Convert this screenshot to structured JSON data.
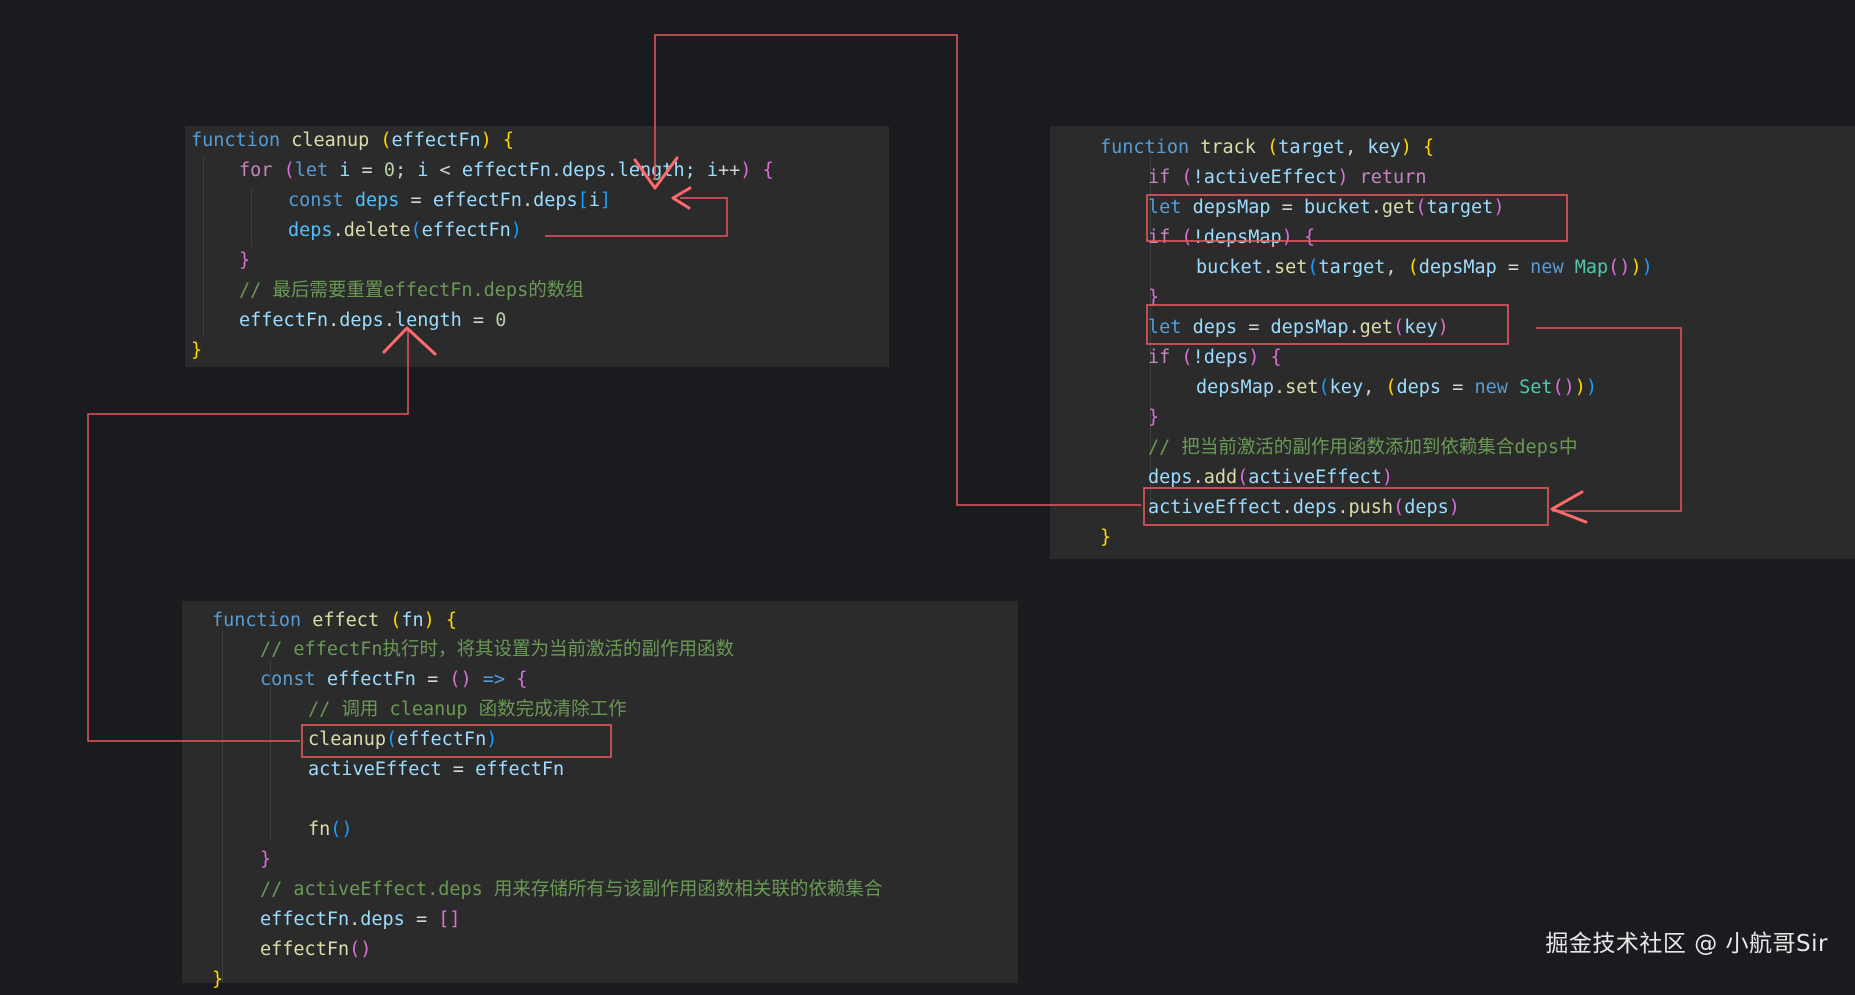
{
  "cleanup": {
    "l1": {
      "a": "function",
      "b": "cleanup",
      "c": "(",
      "d": "effectFn",
      "e": ")",
      "f": "{"
    },
    "l2": {
      "a": "for",
      "b": "(",
      "c": "let",
      "d": "i",
      "e": "=",
      "f": "0",
      "g": ";",
      "h": "i",
      "i": "<",
      "j": "effectFn",
      "k": ".deps.length; ",
      "l": "i",
      "m": "++",
      "n": ")",
      "o": "{"
    },
    "l3": {
      "a": "const",
      "b": "deps",
      "c": "=",
      "d": "effectFn",
      "e": ".",
      "f": "deps",
      "g": "[",
      "h": "i",
      "i": "]"
    },
    "l4": {
      "a": "deps",
      "b": ".",
      "c": "delete",
      "d": "(",
      "e": "effectFn",
      "f": ")"
    },
    "l5": {
      "a": "}"
    },
    "l6": {
      "a": "// 最后需要重置effectFn.deps的数组"
    },
    "l7": {
      "a": "effectFn",
      "b": ".",
      "c": "deps",
      "d": ".",
      "e": "length",
      "f": "=",
      "g": "0"
    },
    "l8": {
      "a": "}"
    }
  },
  "track": {
    "l1": {
      "a": "function",
      "b": "track",
      "c": "(",
      "d": "target",
      "e": ",",
      "f": "key",
      "g": ")",
      "h": "{"
    },
    "l2": {
      "a": "if",
      "b": "(",
      "c": "!activeEffect",
      "d": ")",
      "e": "return"
    },
    "l3": {
      "a": "let",
      "b": "depsMap",
      "c": "=",
      "d": "bucket",
      "e": ".",
      "f": "get",
      "g": "(",
      "h": "target",
      "i": ")"
    },
    "l4": {
      "a": "if",
      "b": "(",
      "c": "!depsMap",
      "d": ")",
      "e": "{"
    },
    "l5": {
      "a": "bucket",
      "b": ".",
      "c": "set",
      "d": "(",
      "e": "target",
      "f": ",",
      "g": "(",
      "h": "depsMap",
      "i": "=",
      "j": "new",
      "k": "Map",
      "l": "()",
      "m": ")",
      "n": ")"
    },
    "l6": {
      "a": "}"
    },
    "l7": {
      "a": "let",
      "b": "deps",
      "c": "=",
      "d": "depsMap",
      "e": ".",
      "f": "get",
      "g": "(",
      "h": "key",
      "i": ")"
    },
    "l8": {
      "a": "if",
      "b": "(",
      "c": "!deps",
      "d": ")",
      "e": "{"
    },
    "l9": {
      "a": "depsMap",
      "b": ".",
      "c": "set",
      "d": "(",
      "e": "key",
      "f": ",",
      "g": "(",
      "h": "deps",
      "i": "=",
      "j": "new",
      "k": "Set",
      "l": "()",
      "m": ")",
      "n": ")"
    },
    "l10": {
      "a": "}"
    },
    "l11": {
      "a": "// 把当前激活的副作用函数添加到依赖集合deps中"
    },
    "l12": {
      "a": "deps",
      "b": ".",
      "c": "add",
      "d": "(",
      "e": "activeEffect",
      "f": ")"
    },
    "l13": {
      "a": "activeEffect",
      "b": ".",
      "c": "deps",
      "d": ".",
      "e": "push",
      "f": "(",
      "g": "deps",
      "h": ")"
    },
    "l14": {
      "a": "}"
    }
  },
  "effect": {
    "l1": {
      "a": "function",
      "b": "effect",
      "c": "(",
      "d": "fn",
      "e": ")",
      "f": "{"
    },
    "l2": {
      "a": "// effectFn执行时，将其设置为当前激活的副作用函数"
    },
    "l3": {
      "a": "const",
      "b": "effectFn",
      "c": "=",
      "d": "()",
      "e": "=>",
      "f": "{"
    },
    "l4": {
      "a": "// 调用 cleanup 函数完成清除工作"
    },
    "l5": {
      "a": "cleanup",
      "b": "(",
      "c": "effectFn",
      "d": ")"
    },
    "l6": {
      "a": "activeEffect",
      "b": "=",
      "c": "effectFn"
    },
    "l7": {
      "a": "fn",
      "b": "()"
    },
    "l8": {
      "a": "}"
    },
    "l9": {
      "a": "// activeEffect.deps 用来存储所有与该副作用函数相关联的依赖集合"
    },
    "l10": {
      "a": "effectFn",
      "b": ".",
      "c": "deps",
      "d": "=",
      "e": "[]"
    },
    "l11": {
      "a": "effectFn",
      "b": "()"
    },
    "l12": {
      "a": "}"
    }
  },
  "watermark": "掘金技术社区 @ 小航哥Sir",
  "colors": {
    "keyword": "#569cd6",
    "function": "#dcdcaa",
    "variable": "#9cdcfe",
    "comment": "#6a9955",
    "annotation": "#e8585e"
  }
}
